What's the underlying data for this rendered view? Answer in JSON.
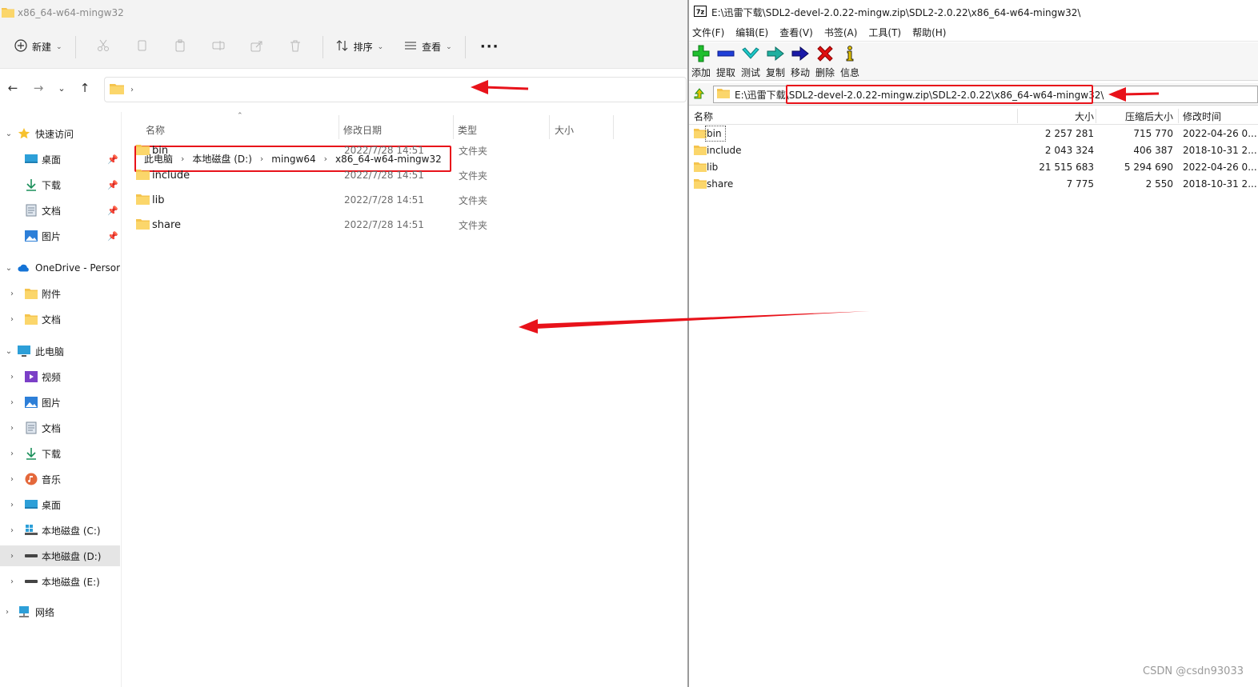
{
  "explorer": {
    "title": "x86_64-w64-mingw32",
    "toolbar": {
      "new_label": "新建",
      "sort_label": "排序",
      "view_label": "查看",
      "more_label": "···"
    },
    "breadcrumb": [
      "此电脑",
      "本地磁盘 (D:)",
      "mingw64",
      "x86_64-w64-mingw32"
    ],
    "nav": {
      "quick_access": "快速访问",
      "qa_items": [
        "桌面",
        "下载",
        "文档",
        "图片"
      ],
      "onedrive": "OneDrive - Persor",
      "od_items": [
        "附件",
        "文档"
      ],
      "this_pc": "此电脑",
      "pc_items": [
        "视频",
        "图片",
        "文档",
        "下载",
        "音乐",
        "桌面",
        "本地磁盘 (C:)",
        "本地磁盘 (D:)",
        "本地磁盘 (E:)"
      ],
      "network": "网络"
    },
    "columns": {
      "name": "名称",
      "date": "修改日期",
      "type": "类型",
      "size": "大小"
    },
    "rows": [
      {
        "name": "bin",
        "date": "2022/7/28 14:51",
        "type": "文件夹"
      },
      {
        "name": "include",
        "date": "2022/7/28 14:51",
        "type": "文件夹"
      },
      {
        "name": "lib",
        "date": "2022/7/28 14:51",
        "type": "文件夹"
      },
      {
        "name": "share",
        "date": "2022/7/28 14:51",
        "type": "文件夹"
      }
    ]
  },
  "zip": {
    "title": "E:\\迅雷下载\\SDL2-devel-2.0.22-mingw.zip\\SDL2-2.0.22\\x86_64-w64-mingw32\\",
    "title_icon": "7z",
    "menu": [
      "文件(F)",
      "编辑(E)",
      "查看(V)",
      "书签(A)",
      "工具(T)",
      "帮助(H)"
    ],
    "tools": [
      "添加",
      "提取",
      "测试",
      "复制",
      "移动",
      "删除",
      "信息"
    ],
    "address": "E:\\迅雷下载\\SDL2-devel-2.0.22-mingw.zip\\SDL2-2.0.22\\x86_64-w64-mingw32\\",
    "columns": {
      "name": "名称",
      "size": "大小",
      "packed": "压缩后大小",
      "modified": "修改时间"
    },
    "rows": [
      {
        "name": "bin",
        "size": "2 257 281",
        "packed": "715 770",
        "modified": "2022-04-26 0..."
      },
      {
        "name": "include",
        "size": "2 043 324",
        "packed": "406 387",
        "modified": "2018-10-31 2..."
      },
      {
        "name": "lib",
        "size": "21 515 683",
        "packed": "5 294 690",
        "modified": "2022-04-26 0..."
      },
      {
        "name": "share",
        "size": "7 775",
        "packed": "2 550",
        "modified": "2018-10-31 2..."
      }
    ]
  },
  "watermark": "CSDN @csdn93033",
  "colors": {
    "annotation": "#e8121a",
    "folder": "#f5c44e",
    "selected": "#e5e5e5"
  }
}
